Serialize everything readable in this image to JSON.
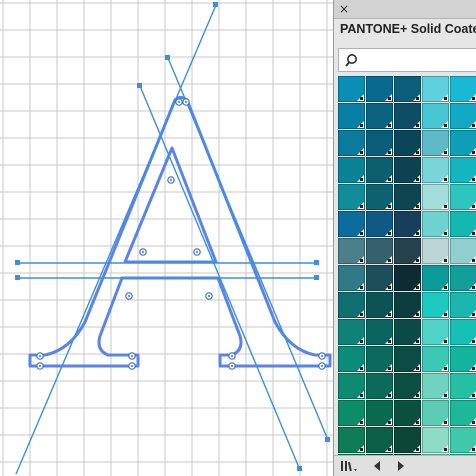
{
  "artboard": {
    "grid_color": "#c9c9c9",
    "path_color": "#5b84e8",
    "handle_line_color": "#3a8fe0"
  },
  "panel": {
    "close_glyph": "×",
    "title": "PANTONE+ Solid Coated",
    "search_icon": "magnifier-icon",
    "footer": {
      "library_icon": "swatch-library-icon",
      "prev_icon": "triangle-left-icon",
      "next_icon": "triangle-right-icon"
    },
    "swatches": [
      [
        "#0a8fb4",
        "#066b8f",
        "#0b5f7a",
        "#5fd0de",
        "#1bb8d6"
      ],
      [
        "#0a7fa6",
        "#0b6382",
        "#0d4e66",
        "#49c6d4",
        "#12a9c4"
      ],
      [
        "#0c7a9c",
        "#0a5d78",
        "#0b4558",
        "#5fb9c7",
        "#0f9fb6"
      ],
      [
        "#0a8396",
        "#0b5f6e",
        "#0d4352",
        "#79d5d8",
        "#13b6c0"
      ],
      [
        "#138c9a",
        "#0d6470",
        "#0d4650",
        "#a4dedc",
        "#2ec4bf"
      ],
      [
        "#0b6d9e",
        "#0f5a82",
        "#173e5a",
        "#6dd3d0",
        "#15b8b0"
      ],
      [
        "#4a7f8b",
        "#36626e",
        "#25424d",
        "#bcd6d8",
        "#8fcfd0"
      ],
      [
        "#2f7a86",
        "#1c4f5a",
        "#0e2a33",
        "#0c9a9b",
        "#129e9b"
      ],
      [
        "#0f6f70",
        "#0b5354",
        "#0c3e3f",
        "#1ec9c0",
        "#1bb6ad"
      ],
      [
        "#0e8179",
        "#0a645f",
        "#0b4a47",
        "#4fd3c7",
        "#16c0b4"
      ],
      [
        "#0c8a7a",
        "#0a6a5e",
        "#0b4c45",
        "#3bc9b6",
        "#12b39f"
      ],
      [
        "#0e8a72",
        "#0b6a58",
        "#0d4f43",
        "#6fd3bf",
        "#25bfa4"
      ],
      [
        "#0d8c68",
        "#0a6b50",
        "#0b503f",
        "#5ccdb4",
        "#1db79a"
      ],
      [
        "#0e7c57",
        "#0b5f46",
        "#0c4637",
        "#8edbc6",
        "#40c9a9"
      ],
      [
        "#0d7f5d",
        "#0b5f47",
        "#0a4434",
        "#7ad0b8",
        "#2ab896"
      ]
    ]
  }
}
